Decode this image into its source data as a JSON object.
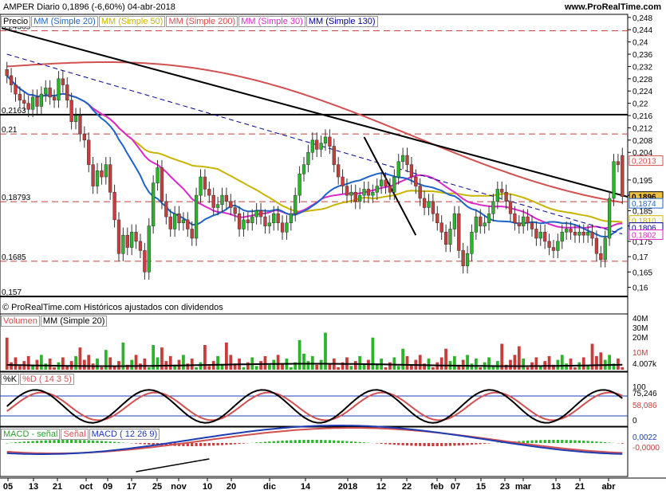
{
  "header": {
    "title": "AMPER  Diario  0,1896 (-6,60%)  04-abr-2018",
    "site": "www.ProRealTime.com"
  },
  "legends": {
    "price": [
      {
        "label": "Precio",
        "color": "#000000"
      },
      {
        "label": "MM (Simple 20)",
        "color": "#1e64c8"
      },
      {
        "label": "MM (Simple 50)",
        "color": "#c8b400"
      },
      {
        "label": "MM (Simple 200)",
        "color": "#d25050"
      },
      {
        "label": "MM (Simple 30)",
        "color": "#dc28c8"
      },
      {
        "label": "MM (Simple 130)",
        "color": "#000096"
      }
    ],
    "volume": [
      {
        "label": "Volumen",
        "color": "#d25050"
      },
      {
        "label": "MM (Simple 20)",
        "color": "#000000"
      }
    ],
    "stoch": [
      {
        "label": "%K",
        "color": "#000000"
      },
      {
        "label": "%D ( 14 3 5)",
        "color": "#d25050"
      }
    ],
    "macd": [
      {
        "label": "MACD - señal",
        "color": "#2ca02c"
      },
      {
        "label": "Señal",
        "color": "#d25050"
      },
      {
        "label": "MACD ( 12 26 9)",
        "color": "#1e3cb4"
      }
    ]
  },
  "copyright": "© ProRealTime.com  Históricos ajustados con dividendos",
  "price_left_labels": [
    "0,24365",
    "0,2163",
    "0,21",
    "0,18793",
    "0,1685",
    "0,157"
  ],
  "price_right_ticks": [
    "0,248",
    "0,244",
    "0,24",
    "0,236",
    "0,232",
    "0,228",
    "0,224",
    "0,22",
    "0,216",
    "0,212",
    "0,208",
    "0,204",
    "0,195",
    "0,19",
    "0,185",
    "0,18",
    "0,175",
    "0,17",
    "0,165",
    "0,16"
  ],
  "price_badges": [
    {
      "text": "0,2013",
      "color": "#d25050"
    },
    {
      "text": "0,1896",
      "color": "#000000"
    },
    {
      "text": "0,1874",
      "color": "#1e64c8"
    },
    {
      "text": "0,1810",
      "color": "#c8b400"
    },
    {
      "text": "0,1806",
      "color": "#000096"
    },
    {
      "text": "0,1802",
      "color": "#dc28c8"
    }
  ],
  "volume_ticks": [
    "40M",
    "30M",
    "20M",
    "10M",
    "4.007k"
  ],
  "stoch_ticks": [
    "100",
    "75,246",
    "58,086",
    "0"
  ],
  "macd_ticks": [
    "0,0022",
    "-0,0000"
  ],
  "x_ticks": [
    "05",
    "13",
    "21",
    "oct",
    "09",
    "17",
    "25",
    "nov",
    "10",
    "20",
    "dic",
    "14",
    "2018",
    "12",
    "22",
    "feb",
    "07",
    "15",
    "23",
    "mar",
    "13",
    "21",
    "abr"
  ],
  "chart_data": {
    "type": "candlestick",
    "title": "AMPER Diario",
    "last_close": 0.1896,
    "change_pct": -6.6,
    "date": "04-abr-2018",
    "ylim": [
      0.156,
      0.249
    ],
    "close": [
      0.229,
      0.226,
      0.223,
      0.221,
      0.22,
      0.218,
      0.222,
      0.219,
      0.223,
      0.225,
      0.222,
      0.221,
      0.228,
      0.226,
      0.221,
      0.214,
      0.216,
      0.21,
      0.208,
      0.2,
      0.193,
      0.198,
      0.196,
      0.2,
      0.191,
      0.182,
      0.171,
      0.177,
      0.173,
      0.178,
      0.175,
      0.172,
      0.165,
      0.18,
      0.194,
      0.199,
      0.188,
      0.183,
      0.179,
      0.184,
      0.181,
      0.182,
      0.179,
      0.176,
      0.19,
      0.196,
      0.192,
      0.19,
      0.186,
      0.187,
      0.19,
      0.188,
      0.186,
      0.184,
      0.179,
      0.182,
      0.181,
      0.183,
      0.185,
      0.183,
      0.18,
      0.181,
      0.184,
      0.181,
      0.178,
      0.181,
      0.184,
      0.19,
      0.197,
      0.2,
      0.204,
      0.208,
      0.205,
      0.207,
      0.209,
      0.206,
      0.2,
      0.196,
      0.193,
      0.19,
      0.191,
      0.188,
      0.19,
      0.192,
      0.19,
      0.191,
      0.193,
      0.195,
      0.193,
      0.191,
      0.196,
      0.201,
      0.203,
      0.2,
      0.196,
      0.193,
      0.189,
      0.186,
      0.188,
      0.184,
      0.181,
      0.178,
      0.174,
      0.179,
      0.184,
      0.172,
      0.167,
      0.171,
      0.178,
      0.183,
      0.18,
      0.181,
      0.184,
      0.188,
      0.192,
      0.191,
      0.188,
      0.184,
      0.181,
      0.18,
      0.183,
      0.181,
      0.179,
      0.176,
      0.178,
      0.175,
      0.173,
      0.172,
      0.175,
      0.178,
      0.179,
      0.178,
      0.177,
      0.178,
      0.177,
      0.178,
      0.176,
      0.171,
      0.169,
      0.176,
      0.189,
      0.201,
      0.2,
      0.1896
    ],
    "open": [
      0.231,
      0.229,
      0.226,
      0.223,
      0.221,
      0.22,
      0.218,
      0.222,
      0.219,
      0.223,
      0.225,
      0.222,
      0.221,
      0.228,
      0.226,
      0.221,
      0.214,
      0.216,
      0.21,
      0.208,
      0.2,
      0.193,
      0.198,
      0.196,
      0.2,
      0.191,
      0.182,
      0.171,
      0.177,
      0.173,
      0.178,
      0.175,
      0.172,
      0.165,
      0.18,
      0.194,
      0.199,
      0.188,
      0.183,
      0.179,
      0.184,
      0.181,
      0.182,
      0.179,
      0.176,
      0.19,
      0.196,
      0.192,
      0.19,
      0.186,
      0.187,
      0.19,
      0.188,
      0.186,
      0.184,
      0.179,
      0.182,
      0.181,
      0.183,
      0.185,
      0.183,
      0.18,
      0.181,
      0.184,
      0.181,
      0.178,
      0.181,
      0.184,
      0.19,
      0.197,
      0.2,
      0.204,
      0.208,
      0.205,
      0.207,
      0.209,
      0.206,
      0.2,
      0.196,
      0.193,
      0.19,
      0.191,
      0.188,
      0.19,
      0.192,
      0.19,
      0.191,
      0.193,
      0.195,
      0.193,
      0.191,
      0.196,
      0.201,
      0.203,
      0.2,
      0.196,
      0.193,
      0.189,
      0.186,
      0.188,
      0.184,
      0.181,
      0.178,
      0.174,
      0.179,
      0.184,
      0.172,
      0.167,
      0.171,
      0.178,
      0.183,
      0.18,
      0.181,
      0.184,
      0.188,
      0.192,
      0.191,
      0.188,
      0.184,
      0.181,
      0.18,
      0.183,
      0.181,
      0.179,
      0.176,
      0.178,
      0.175,
      0.173,
      0.172,
      0.175,
      0.178,
      0.179,
      0.178,
      0.177,
      0.178,
      0.177,
      0.178,
      0.176,
      0.171,
      0.169,
      0.176,
      0.189,
      0.201,
      0.203
    ],
    "sma20_end": 0.1874,
    "sma50_end": 0.181,
    "sma200_end": 0.2013,
    "sma30_end": 0.1802,
    "sma130_end": 0.1806,
    "horizontal_levels": [
      0.24365,
      0.2163,
      0.21,
      0.18793,
      0.1685,
      0.157
    ],
    "volume_ma20": 4.007,
    "stoch": {
      "k": 75.246,
      "d": 58.086
    },
    "macd": {
      "hist": 0.0022,
      "signal": -0.0
    }
  }
}
